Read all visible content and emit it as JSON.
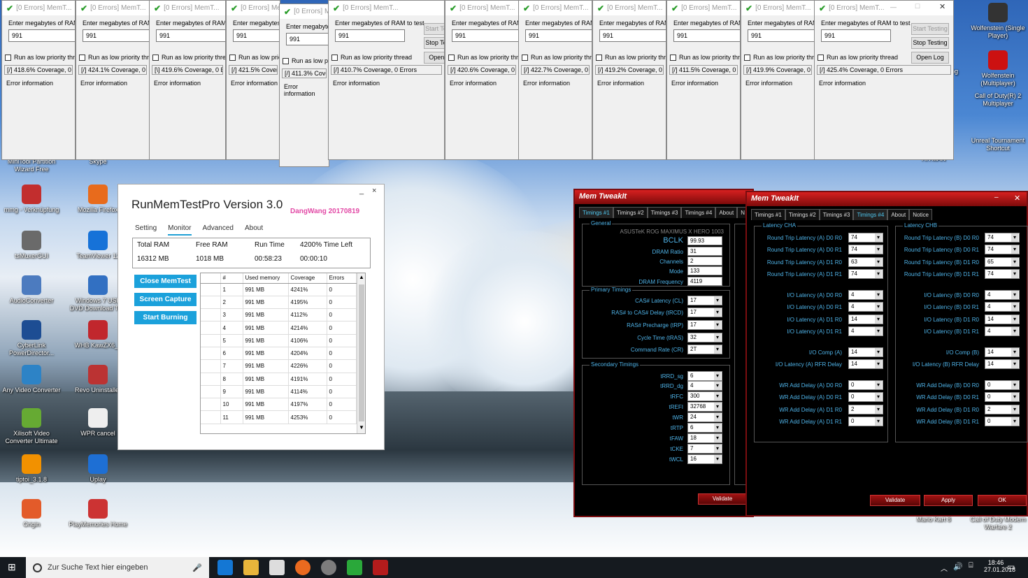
{
  "memtest": {
    "title": "[0 Errors] MemT...",
    "prompt": "Enter megabytes of RAM to test",
    "value": "991",
    "low_priority": "Run as low priority thread",
    "error_info": "Error information",
    "start": "Start Testing",
    "stop": "Stop Testing",
    "open_log": "Open Log",
    "coverages": [
      "[/]  418.6% Coverage, 0 Errors",
      "[/]  424.1% Coverage, 0 Errors",
      "[\\]  419.6% Coverage, 0 Errors",
      "[/]  421.5% Coverage, 0 Errors",
      "[/]  411.3% Coverage, 0 Errors",
      "[/]  410.7% Coverage, 0 Errors",
      "[/]  420.6% Coverage, 0 Errors",
      "[/]  422.7% Coverage, 0 Errors",
      "[/]  419.2% Coverage, 0 Errors",
      "[/]  411.5% Coverage, 0 Errors",
      "[/]  419.9% Coverage, 0 Errors",
      "[/]  425.4% Coverage, 0 Errors"
    ]
  },
  "desktop": {
    "icons": [
      "MiniTool Partition Wizard Free",
      "Skype",
      "mmg - Verknüpfung",
      "Mozilla Firefox",
      "tsMuxerGUI",
      "TeamViewer 12",
      "AudioConverter",
      "Windows 7 USB DVD Download Tool",
      "CyberLink PowerDirector...",
      "WHB KawZX6_c",
      "Any Video Converter",
      "Revo Uninstaller",
      "Xilisoft Video Converter Ultimate",
      "WPR cancel",
      "tiptoi_3.1.8",
      "Uplay",
      "Origin",
      "PlayMemories Home",
      "Wolfenstein (Single Player)",
      "Wolfenstein (Multiplayer)",
      "Call of Duty(R) 2 Multiplayer",
      "Unreal Tournament Shortcut",
      "HITMAN",
      "Mario Kart 8",
      "Call of Duty Modern Warfare 2",
      "ng"
    ]
  },
  "rmt": {
    "title": "RunMemTestPro Version 3.0",
    "author": "DangWang  20170819",
    "min": "_",
    "close": "×",
    "tabs": [
      "Setting",
      "Monitor",
      "Advanced",
      "About"
    ],
    "labels": {
      "total": "Total RAM",
      "free": "Free RAM",
      "runtime": "Run Time",
      "timeleft": "4200% Time Left"
    },
    "values": {
      "total": "16312 MB",
      "free": "1018 MB",
      "runtime": "00:58:23",
      "timeleft": "00:00:10"
    },
    "buttons": [
      "Close MemTest",
      "Screen Capture",
      "Start Burning"
    ],
    "columns": [
      "#",
      "Used memory",
      "Coverage",
      "Errors"
    ],
    "rows": [
      [
        "1",
        "991 MB",
        "4241%",
        "0"
      ],
      [
        "2",
        "991 MB",
        "4195%",
        "0"
      ],
      [
        "3",
        "991 MB",
        "4112%",
        "0"
      ],
      [
        "4",
        "991 MB",
        "4214%",
        "0"
      ],
      [
        "5",
        "991 MB",
        "4106%",
        "0"
      ],
      [
        "6",
        "991 MB",
        "4204%",
        "0"
      ],
      [
        "7",
        "991 MB",
        "4226%",
        "0"
      ],
      [
        "8",
        "991 MB",
        "4191%",
        "0"
      ],
      [
        "9",
        "991 MB",
        "4114%",
        "0"
      ],
      [
        "10",
        "991 MB",
        "4197%",
        "0"
      ],
      [
        "11",
        "991 MB",
        "4253%",
        "0"
      ]
    ]
  },
  "tweak1": {
    "title": "Mem TweakIt",
    "tabs": [
      "Timings #1",
      "Timings #2",
      "Timings #3",
      "Timings #4",
      "About",
      "N"
    ],
    "general_title": "General",
    "board": "ASUSTeK ROG MAXIMUS X HERO 1003",
    "general": [
      [
        "BCLK",
        "99.93"
      ],
      [
        "DRAM Ratio",
        "31"
      ],
      [
        "Channels",
        "2"
      ],
      [
        "Mode",
        "133"
      ],
      [
        "DRAM Frequency",
        "4119"
      ]
    ],
    "primary_title": "Primary Timings",
    "primary": [
      [
        "CAS# Latency (CL)",
        "17"
      ],
      [
        "RAS# to CAS# Delay (tRCD)",
        "17"
      ],
      [
        "RAS# Precharge (tRP)",
        "17"
      ],
      [
        "Cycle Time (tRAS)",
        "32"
      ],
      [
        "Command Rate (CR)",
        "2T"
      ]
    ],
    "secondary_title": "Secondary Timings",
    "secondary": [
      [
        "tRRD_sg",
        "6"
      ],
      [
        "tRRD_dg",
        "4"
      ],
      [
        "tRFC",
        "300"
      ],
      [
        "tREFI",
        "32768"
      ],
      [
        "tWR",
        "24"
      ],
      [
        "tRTP",
        "6"
      ],
      [
        "tFAW",
        "18"
      ],
      [
        "tCKE",
        "7"
      ],
      [
        "tWCL",
        "16"
      ]
    ],
    "validate": "Validate"
  },
  "tweak2": {
    "title": "Mem TweakIt",
    "tabs": [
      "Timings #1",
      "Timings #2",
      "Timings #3",
      "Timings #4",
      "About",
      "Notice"
    ],
    "cha_title": "Latency CHA",
    "chb_title": "Latency CHB",
    "cha": [
      [
        "Round Trip Latency (A) D0 R0",
        "74"
      ],
      [
        "Round Trip Latency (A) D0 R1",
        "74"
      ],
      [
        "Round Trip Latency (A) D1 R0",
        "63"
      ],
      [
        "Round Trip Latency (A) D1 R1",
        "74"
      ],
      [
        "I/O Latency (A) D0 R0",
        "4"
      ],
      [
        "I/O Latency (A) D0 R1",
        "4"
      ],
      [
        "I/O Latency (A) D1 R0",
        "14"
      ],
      [
        "I/O Latency (A) D1 R1",
        "4"
      ],
      [
        "I/O Comp (A)",
        "14"
      ],
      [
        "I/O Latency (A) RFR Delay",
        "14"
      ],
      [
        "WR Add Delay (A) D0 R0",
        "0"
      ],
      [
        "WR Add Delay (A) D0 R1",
        "0"
      ],
      [
        "WR Add Delay (A) D1 R0",
        "2"
      ],
      [
        "WR Add Delay (A) D1 R1",
        "0"
      ]
    ],
    "chb": [
      [
        "Round Trip Latency (B) D0 R0",
        "74"
      ],
      [
        "Round Trip Latency (B) D0 R1",
        "74"
      ],
      [
        "Round Trip Latency (B) D1 R0",
        "65"
      ],
      [
        "Round Trip Latency (B) D1 R1",
        "74"
      ],
      [
        "I/O Latency (B) D0 R0",
        "4"
      ],
      [
        "I/O Latency (B) D0 R1",
        "4"
      ],
      [
        "I/O Latency (B) D1 R0",
        "14"
      ],
      [
        "I/O Latency (B) D1 R1",
        "4"
      ],
      [
        "I/O Comp (B)",
        "14"
      ],
      [
        "I/O Latency (B) RFR Delay",
        "14"
      ],
      [
        "WR Add Delay (B) D0 R0",
        "0"
      ],
      [
        "WR Add Delay (B) D0 R1",
        "0"
      ],
      [
        "WR Add Delay (B) D1 R0",
        "2"
      ],
      [
        "WR Add Delay (B) D1 R1",
        "0"
      ]
    ],
    "validate": "Validate",
    "apply": "Apply",
    "ok": "OK"
  },
  "taskbar": {
    "search": "Zur Suche Text hier eingeben",
    "time": "18:46",
    "date": "27.01.2018"
  }
}
